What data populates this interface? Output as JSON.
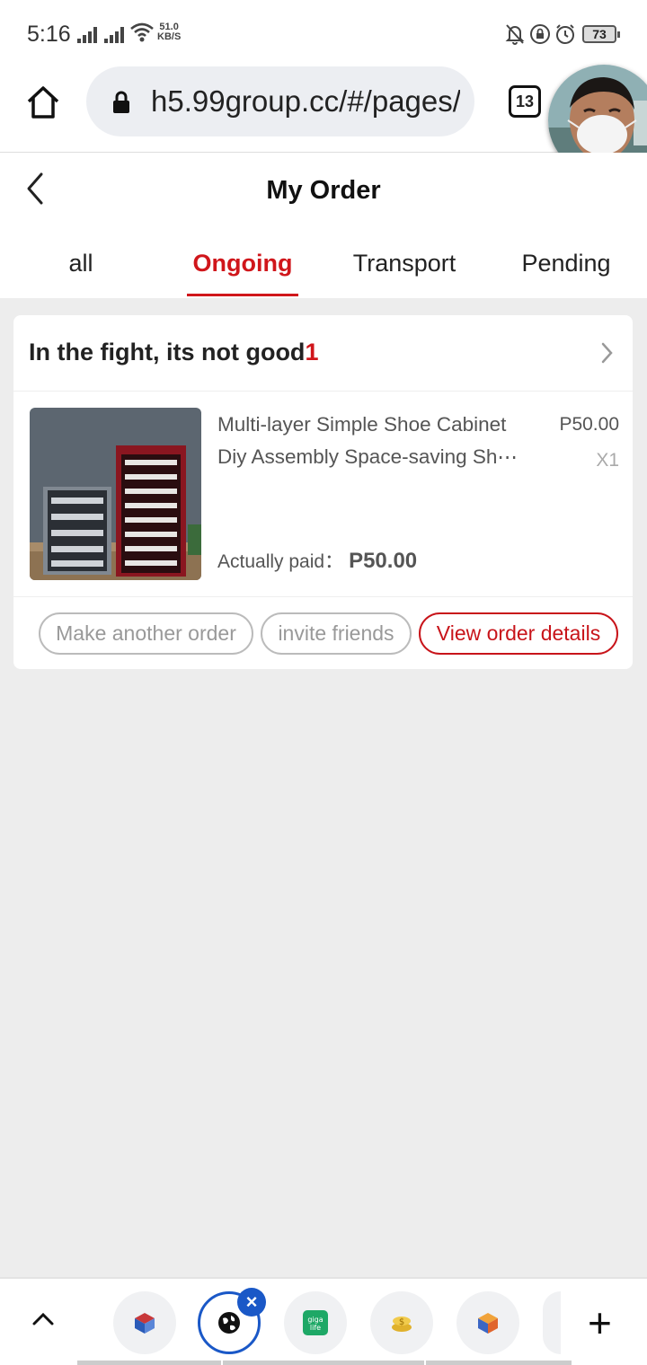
{
  "status_bar": {
    "time": "5:16",
    "net_speed_value": "51.0",
    "net_speed_unit": "KB/S",
    "battery": "73",
    "icons": [
      "signal-icon",
      "signal-icon",
      "wifi-icon",
      "bell-off-icon",
      "lock-rotation-icon",
      "alarm-icon",
      "battery-icon"
    ]
  },
  "browser": {
    "url": "h5.99group.cc/#/pages/",
    "tab_count": "13",
    "icons": [
      "home-icon",
      "lock-icon",
      "tabs-icon"
    ]
  },
  "header": {
    "title": "My Order",
    "tabs": [
      {
        "label": "all",
        "active": false
      },
      {
        "label": "Ongoing",
        "active": true
      },
      {
        "label": "Transport",
        "active": false
      },
      {
        "label": "Pending",
        "active": false
      }
    ]
  },
  "order": {
    "shop_name": "In the fight, its not good",
    "shop_suffix": "1",
    "product_name": "Multi-layer Simple Shoe Cabinet Diy Assembly Space-saving Sh⋯",
    "unit_price": "P50.00",
    "quantity": "X1",
    "paid_label": "Actually paid：",
    "paid_amount": "P50.00",
    "buttons": {
      "reorder": "Make another order",
      "invite": "invite friends",
      "details": "View order details"
    }
  },
  "bottom_bar": {
    "icons": [
      "chevron-up-icon",
      "app-cube-icon",
      "browser-globe-icon",
      "close-icon",
      "giga-life-icon",
      "coins-icon",
      "box-app-icon",
      "plus-icon"
    ],
    "accent": "#1a58c7"
  },
  "colors": {
    "accent_red": "#d0161b",
    "background": "#ededed"
  }
}
